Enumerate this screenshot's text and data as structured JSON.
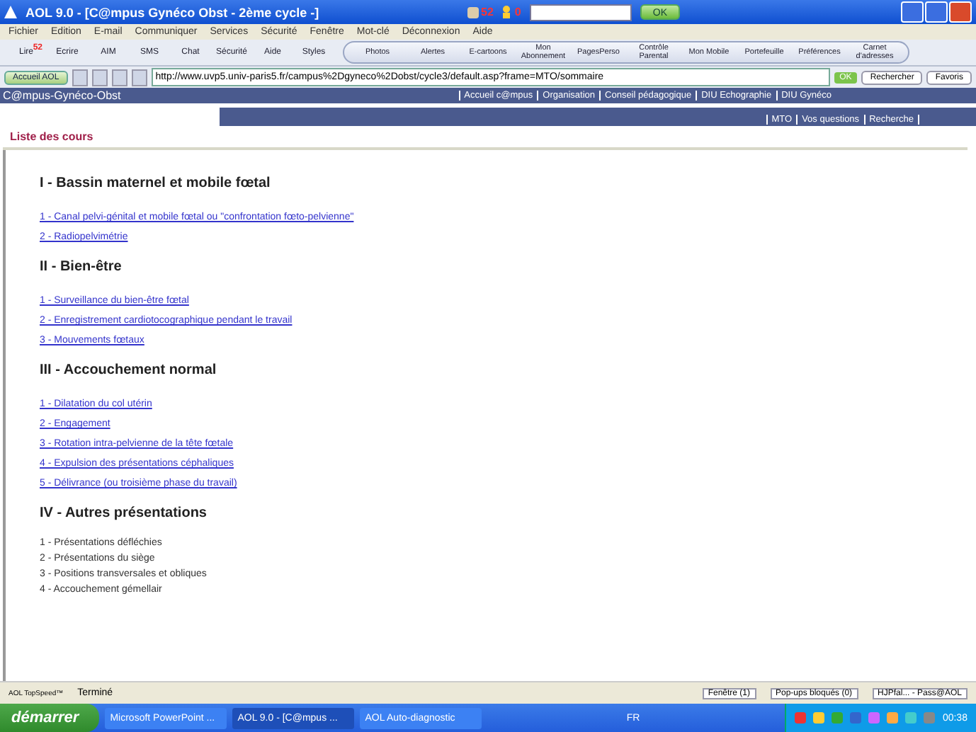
{
  "window": {
    "title": "AOL 9.0 - [C@mpus Gynéco Obst - 2ème cycle -]",
    "mail_count": "52",
    "im_count": "0",
    "ok_button": "OK"
  },
  "menu": [
    "Fichier",
    "Edition",
    "E-mail",
    "Communiquer",
    "Services",
    "Sécurité",
    "Fenêtre",
    "Mot-clé",
    "Déconnexion",
    "Aide"
  ],
  "toolbar": {
    "mail_badge": "52",
    "items": [
      "Lire",
      "Ecrire",
      "AIM",
      "SMS",
      "Chat",
      "Sécurité",
      "Aide",
      "Styles"
    ],
    "group": [
      "Photos",
      "Alertes",
      "E-cartoons",
      "Mon Abonnement",
      "PagesPerso",
      "Contrôle Parental",
      "Mon Mobile",
      "Portefeuille",
      "Préférences",
      "Carnet d'adresses"
    ]
  },
  "address_bar": {
    "home_button": "Accueil AOL",
    "url": "http://www.uvp5.univ-paris5.fr/campus%2Dgyneco%2Dobst/cycle3/default.asp?frame=MTO/sommaire",
    "go_button": "OK",
    "search_button": "Rechercher",
    "favorites_button": "Favoris"
  },
  "site": {
    "logo": "C@mpus-Gynéco-Obst",
    "nav": [
      "Accueil c@mpus",
      "Organisation",
      "Conseil pédagogique",
      "DIU Echographie",
      "DIU Gynéco"
    ],
    "subnav": [
      "MTO",
      "Vos questions",
      "Recherche"
    ],
    "page_title": "Liste des cours",
    "sections": [
      {
        "heading": "I - Bassin maternel et mobile fœtal",
        "items": [
          {
            "kind": "link",
            "text": "1 - Canal pelvi-génital et mobile fœtal ou \"confrontation fœto-pelvienne\""
          },
          {
            "kind": "link",
            "text": "2 - Radiopelvimétrie"
          }
        ]
      },
      {
        "heading": "II - Bien-être",
        "items": [
          {
            "kind": "link",
            "text": "1 - Surveillance du bien-être fœtal"
          },
          {
            "kind": "link",
            "text": "2 - Enregistrement cardiotocographique pendant le travail"
          },
          {
            "kind": "link",
            "text": "3 - Mouvements fœtaux"
          }
        ]
      },
      {
        "heading": "III - Accouchement normal",
        "items": [
          {
            "kind": "link",
            "text": "1 - Dilatation du col utérin"
          },
          {
            "kind": "link",
            "text": "2 - Engagement"
          },
          {
            "kind": "link",
            "text": "3 - Rotation intra-pelvienne de la tête fœtale"
          },
          {
            "kind": "link",
            "text": "4 - Expulsion des présentations céphaliques"
          },
          {
            "kind": "link",
            "text": "5 - Délivrance (ou troisième phase du travail)"
          }
        ]
      },
      {
        "heading": "IV - Autres présentations",
        "items": [
          {
            "kind": "plain",
            "text": "1 - Présentations défléchies"
          },
          {
            "kind": "plain",
            "text": "2 - Présentations du siège"
          },
          {
            "kind": "plain",
            "text": "3 - Positions transversales et obliques"
          },
          {
            "kind": "plain",
            "text": "4 - Accouchement gémellair"
          }
        ]
      }
    ]
  },
  "status_bar": {
    "topspeed": "AOL TopSpeed™",
    "status": "Terminé",
    "windows": "Fenêtre (1)",
    "popups": "Pop-ups bloqués (0)",
    "screen_name": "HJPfal... - Pass@AOL"
  },
  "taskbar": {
    "start": "démarrer",
    "tasks": [
      {
        "label": "Microsoft PowerPoint ...",
        "selected": false
      },
      {
        "label": "AOL 9.0 - [C@mpus ...",
        "selected": true
      },
      {
        "label": "AOL Auto-diagnostic",
        "selected": false
      }
    ],
    "language": "FR",
    "clock": "00:38"
  }
}
